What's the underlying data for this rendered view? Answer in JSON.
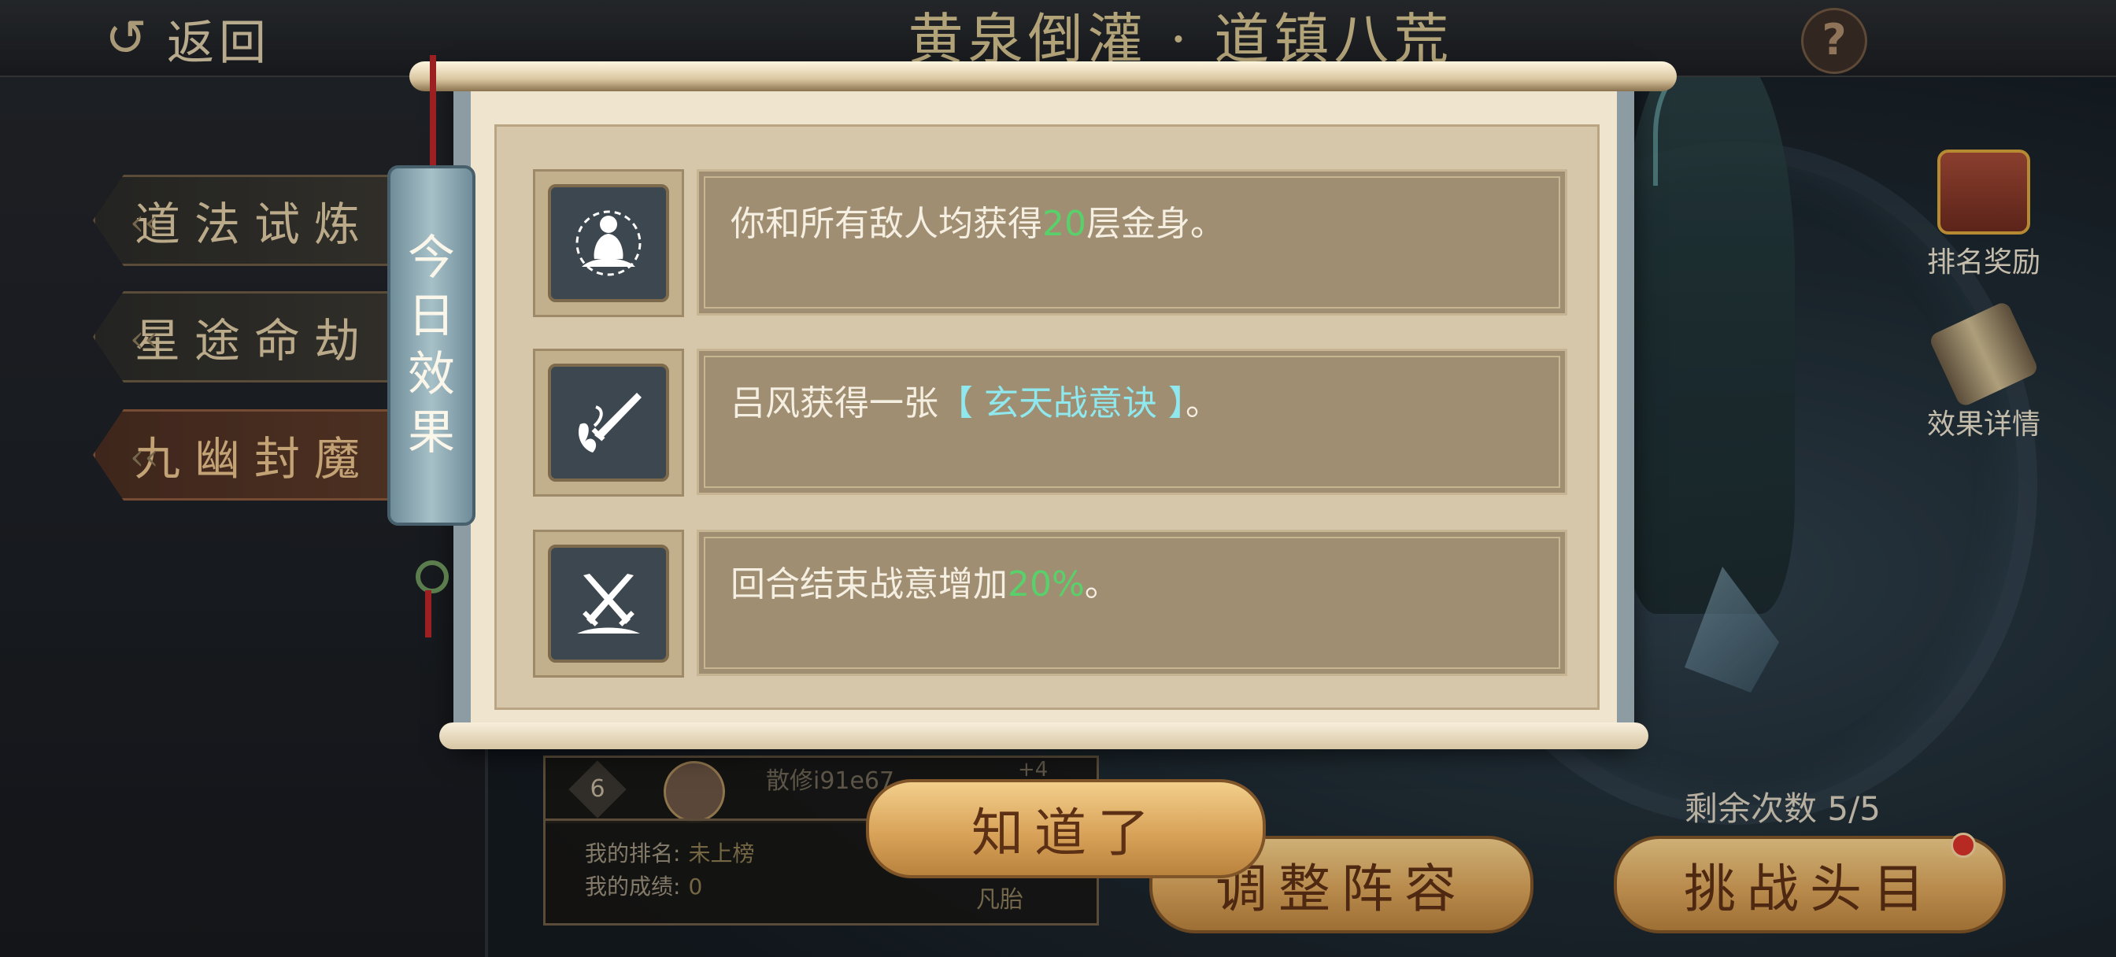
{
  "header": {
    "back_label": "返回",
    "title": "黄泉倒灌 · 道镇八荒",
    "help_label": "?"
  },
  "side_tabs": [
    {
      "label": "道法试炼",
      "active": false
    },
    {
      "label": "星途命劫",
      "active": false
    },
    {
      "label": "九幽封魔",
      "active": true
    }
  ],
  "right_panel": {
    "rank_reward_label": "排名奖励",
    "effect_detail_label": "效果详情"
  },
  "ranking": {
    "peek_rank": "6",
    "peek_name": "散修i91e67",
    "peek_extra": "+4",
    "my_rank_label": "我的排名:",
    "my_rank_value": "未上榜",
    "my_score_label": "我的成绩:",
    "my_score_value": "0",
    "realm": "凡胎"
  },
  "bottom": {
    "remaining": "剩余次数  5/5",
    "adjust_label": "调整阵容",
    "challenge_label": "挑战头目"
  },
  "dialog": {
    "tag_chars": [
      "今",
      "日",
      "效",
      "果"
    ],
    "effects": [
      {
        "icon": "meditating-monk-icon",
        "pre": "你和所有敌人均获得",
        "hl": "20",
        "post": "层金身。"
      },
      {
        "icon": "flaming-sword-icon",
        "pre": "吕风获得一张",
        "hl": "【 玄天战意诀 】",
        "post": "。"
      },
      {
        "icon": "crossed-swords-icon",
        "pre": "回合结束战意增加",
        "hl": "20%",
        "post": "。"
      }
    ],
    "ok_label": "知道了"
  },
  "colors": {
    "highlight_green": "#58d16a",
    "highlight_cyan": "#8fe8ee",
    "button_gold": "#d9a35a"
  }
}
